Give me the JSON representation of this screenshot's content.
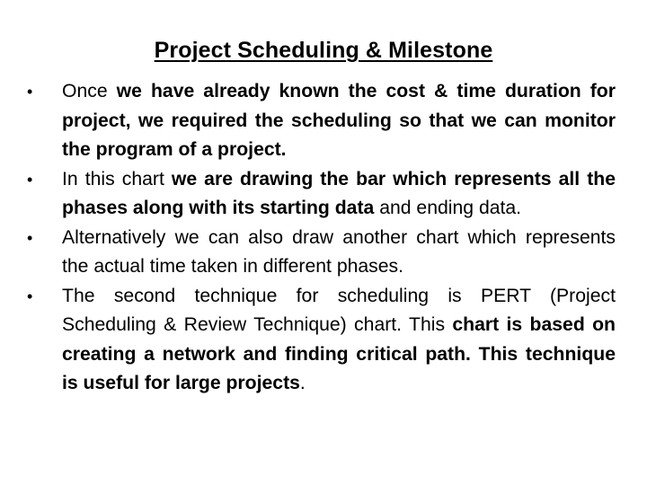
{
  "slide": {
    "title": "Project Scheduling & Milestone",
    "bullet_glyph": "•",
    "bullets": [
      {
        "segments": [
          {
            "text": "Once ",
            "bold": false
          },
          {
            "text": "we have already known the cost & time duration for project, we required the scheduling so that we can monitor the program of a project.",
            "bold": true
          }
        ]
      },
      {
        "segments": [
          {
            "text": "In this chart ",
            "bold": false
          },
          {
            "text": "we are drawing the bar which represents all the phases along with its starting data",
            "bold": true
          },
          {
            "text": " and ending data.",
            "bold": false
          }
        ]
      },
      {
        "segments": [
          {
            "text": "Alternatively we can also draw another chart which represents the actual time taken in different phases.",
            "bold": false
          }
        ]
      },
      {
        "segments": [
          {
            "text": "The second technique for scheduling is PERT (Project Scheduling & Review Technique) chart. This ",
            "bold": false
          },
          {
            "text": "chart is based on creating a network and finding critical path. This technique is useful for large projects",
            "bold": true
          },
          {
            "text": ".",
            "bold": false
          }
        ]
      }
    ]
  }
}
